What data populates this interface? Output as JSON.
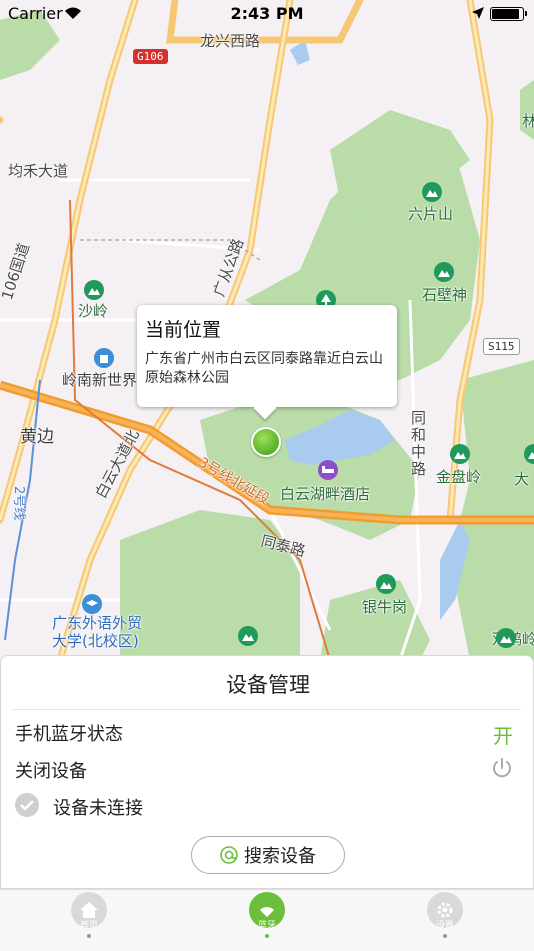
{
  "status_bar": {
    "carrier": "Carrier",
    "time": "2:43 PM",
    "battery_level": 0.95
  },
  "map": {
    "labels": {
      "longxing_rd": "龙兴西路",
      "g106": "G106",
      "junhe_blvd": "均禾大道",
      "g106_vertical": "106国道",
      "guangcong_rd": "广从公路",
      "liupianshan": "六片山",
      "shibishen": "石壁神",
      "s115": "S115",
      "shaling": "沙岭",
      "lingnan": "岭南新世界",
      "huangbian": "黄边",
      "baiyun_blvd": "白云大道北",
      "line3": "3号线北延段",
      "line2": "2号线",
      "tonghe_rd": "同和中路",
      "jinpanling": "金盘岭",
      "dayuan": "大",
      "hotel": "白云湖畔酒店",
      "tongtai_rd": "同泰路",
      "yinniugang": "银牛岗",
      "gdufs": "广东外语外贸大学(北校区)",
      "topright": "林",
      "bottom_poi": "双鹤岭"
    }
  },
  "callout": {
    "title": "当前位置",
    "address": "广东省广州市白云区同泰路靠近白云山原始森林公园"
  },
  "panel": {
    "title": "设备管理",
    "bluetooth_label": "手机蓝牙状态",
    "bluetooth_value": "开",
    "close_device_label": "关闭设备",
    "connection_status": "设备未连接",
    "search_button": "搜索设备",
    "accent_color": "#6bbf3b"
  },
  "tabs": [
    {
      "label": "首页",
      "icon": "home-icon",
      "active": false
    },
    {
      "label": "蓝牙",
      "icon": "bluetooth-wifi-icon",
      "active": true
    },
    {
      "label": "设置",
      "icon": "gear-icon",
      "active": false
    }
  ]
}
